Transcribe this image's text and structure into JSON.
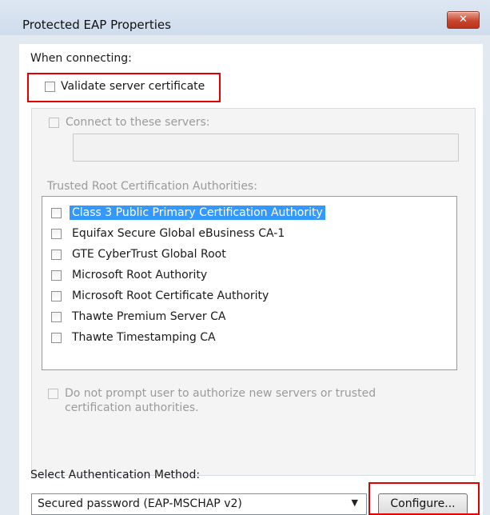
{
  "window": {
    "title": "Protected EAP Properties",
    "close_glyph": "✕"
  },
  "connecting": {
    "heading": "When connecting:",
    "validate_label": "Validate server certificate",
    "connect_servers_label": "Connect to these servers:",
    "servers_value": "",
    "trusted_heading": "Trusted Root Certification Authorities:",
    "authorities": [
      {
        "label": "Class 3 Public Primary Certification Authority",
        "checked": false,
        "selected": true
      },
      {
        "label": "Equifax Secure Global eBusiness CA-1",
        "checked": false,
        "selected": false
      },
      {
        "label": "GTE CyberTrust Global Root",
        "checked": false,
        "selected": false
      },
      {
        "label": "Microsoft Root Authority",
        "checked": false,
        "selected": false
      },
      {
        "label": "Microsoft Root Certificate Authority",
        "checked": false,
        "selected": false
      },
      {
        "label": "Thawte Premium Server CA",
        "checked": false,
        "selected": false
      },
      {
        "label": "Thawte Timestamping CA",
        "checked": false,
        "selected": false
      }
    ],
    "no_prompt_line1": "Do not prompt user to authorize new servers or trusted",
    "no_prompt_line2": "certification authorities."
  },
  "auth": {
    "heading": "Select Authentication Method:",
    "selected_method": "Secured password (EAP-MSCHAP v2)",
    "dropdown_arrow": "▼",
    "configure_label": "Configure..."
  },
  "colors": {
    "highlight_red": "#e00000",
    "selection_blue": "#3399ff"
  }
}
